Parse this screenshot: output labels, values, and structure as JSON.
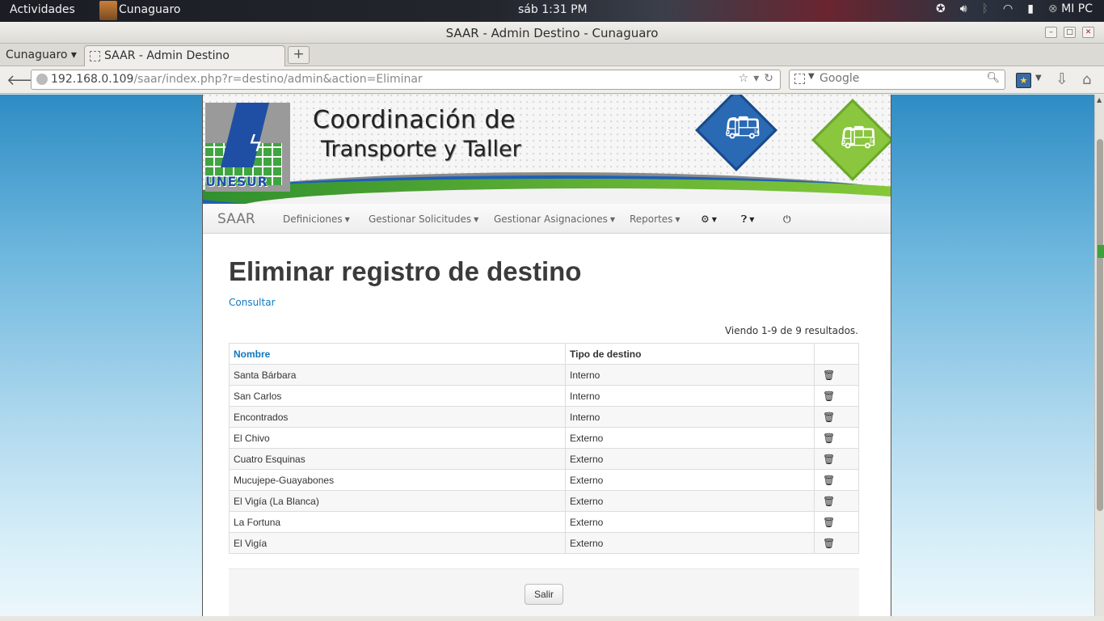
{
  "gnome": {
    "activities": "Actividades",
    "app_name": "Cunaguaro",
    "clock": "sáb  1:31 PM",
    "user": "MI PC"
  },
  "window": {
    "title": "SAAR - Admin Destino - Cunaguaro"
  },
  "browser": {
    "tab_group": "Cunaguaro",
    "tab_title": "SAAR - Admin Destino",
    "url_host": "192.168.0.109",
    "url_path": "/saar/index.php?r=destino/admin&action=Eliminar",
    "search_placeholder": "Google"
  },
  "banner": {
    "line1": "Coordinación de",
    "line2": "Transporte y Taller",
    "logo_text": "UNESUR"
  },
  "nav": {
    "brand": "SAAR",
    "items": [
      "Definiciones",
      "Gestionar Solicitudes",
      "Gestionar Asignaciones",
      "Reportes"
    ],
    "icons": [
      "gear-icon",
      "help-icon",
      "power-icon"
    ]
  },
  "content": {
    "heading": "Eliminar registro de destino",
    "consultar": "Consultar",
    "summary": "Viendo 1-9 de 9 resultados.",
    "columns": [
      "Nombre",
      "Tipo de destino"
    ],
    "rows": [
      {
        "nombre": "Santa Bárbara",
        "tipo": "Interno"
      },
      {
        "nombre": "San Carlos",
        "tipo": "Interno"
      },
      {
        "nombre": "Encontrados",
        "tipo": "Interno"
      },
      {
        "nombre": "El Chivo",
        "tipo": "Externo"
      },
      {
        "nombre": "Cuatro Esquinas",
        "tipo": "Externo"
      },
      {
        "nombre": "Mucujepe-Guayabones",
        "tipo": "Externo"
      },
      {
        "nombre": "El Vigía (La Blanca)",
        "tipo": "Externo"
      },
      {
        "nombre": "La Fortuna",
        "tipo": "Externo"
      },
      {
        "nombre": "El Vigía",
        "tipo": "Externo"
      }
    ],
    "exit_button": "Salir"
  },
  "colors": {
    "link": "#0e77c0",
    "heading": "#3b3b3b"
  }
}
